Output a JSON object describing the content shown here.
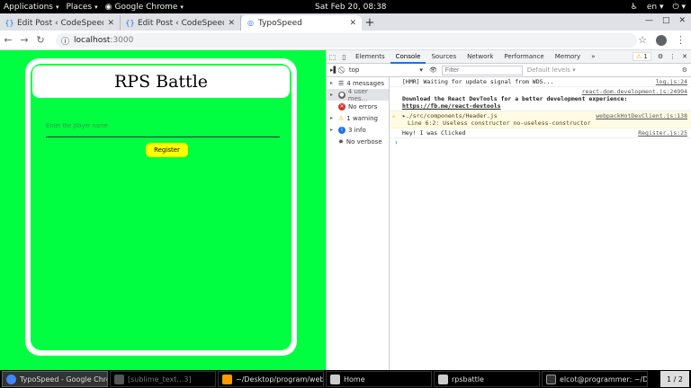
{
  "topbar": {
    "applications": "Applications",
    "places": "Places",
    "chrome": "Google Chrome",
    "clock": "Sat Feb 20, 08:38",
    "lang": "en"
  },
  "tabs": [
    {
      "title": "Edit Post ‹ CodeSpeedy —",
      "icon": "wordpress-icon"
    },
    {
      "title": "Edit Post ‹ CodeSpeedy —",
      "icon": "wordpress-icon"
    },
    {
      "title": "TypoSpeed",
      "icon": "globe-icon"
    }
  ],
  "omnibox": {
    "host": "localhost",
    "port": ":3000"
  },
  "app": {
    "title": "RPS Battle",
    "input_placeholder": "Enter the player name",
    "register_label": "Register",
    "background_color": "#00ff41",
    "button_color": "#ffff00"
  },
  "devtools": {
    "tabs": [
      "Elements",
      "Console",
      "Sources",
      "Network",
      "Performance",
      "Memory"
    ],
    "more": "»",
    "warning_count": "1",
    "context": "top",
    "filter_placeholder": "Filter",
    "levels": "Default levels ▾",
    "sidebar": [
      {
        "label": "4 messages",
        "icon": "list-icon"
      },
      {
        "label": "4 user mes…",
        "icon": "user-icon"
      },
      {
        "label": "No errors",
        "icon": "error-icon"
      },
      {
        "label": "1 warning",
        "icon": "warning-icon"
      },
      {
        "label": "3 info",
        "icon": "info-icon"
      },
      {
        "label": "No verbose",
        "icon": "verbose-icon"
      }
    ],
    "messages": {
      "m1_text": "[HMR] Waiting for update signal from WDS...",
      "m1_src": "log.js:24",
      "m2_src": "react-dom.development.js:24994",
      "m2_text": "Download the React DevTools for a better development experience:",
      "m2_link": "https://fb.me/react-devtools",
      "m3_text": "▸./src/components/Header.js",
      "m3_src": "webpackHotDevClient.js:138",
      "m3_detail": "Line 6:2:  Useless constructor  no-useless-constructor",
      "m4_text": "Hey! I was Clicked",
      "m4_src": "Register.js:25"
    }
  },
  "taskbar": [
    {
      "label": "TypoSpeed - Google Chro…",
      "icon": "chrome-icon"
    },
    {
      "label": "[sublime_text…3]",
      "icon": "sublime-icon"
    },
    {
      "label": "~/Desktop/program/web/r…",
      "icon": "sublime-icon"
    },
    {
      "label": "Home",
      "icon": "folder-icon"
    },
    {
      "label": "rpsbattle",
      "icon": "folder-icon"
    },
    {
      "label": "elcot@programmer: ~/Des…",
      "icon": "terminal-icon"
    }
  ],
  "pager": "1 / 2"
}
